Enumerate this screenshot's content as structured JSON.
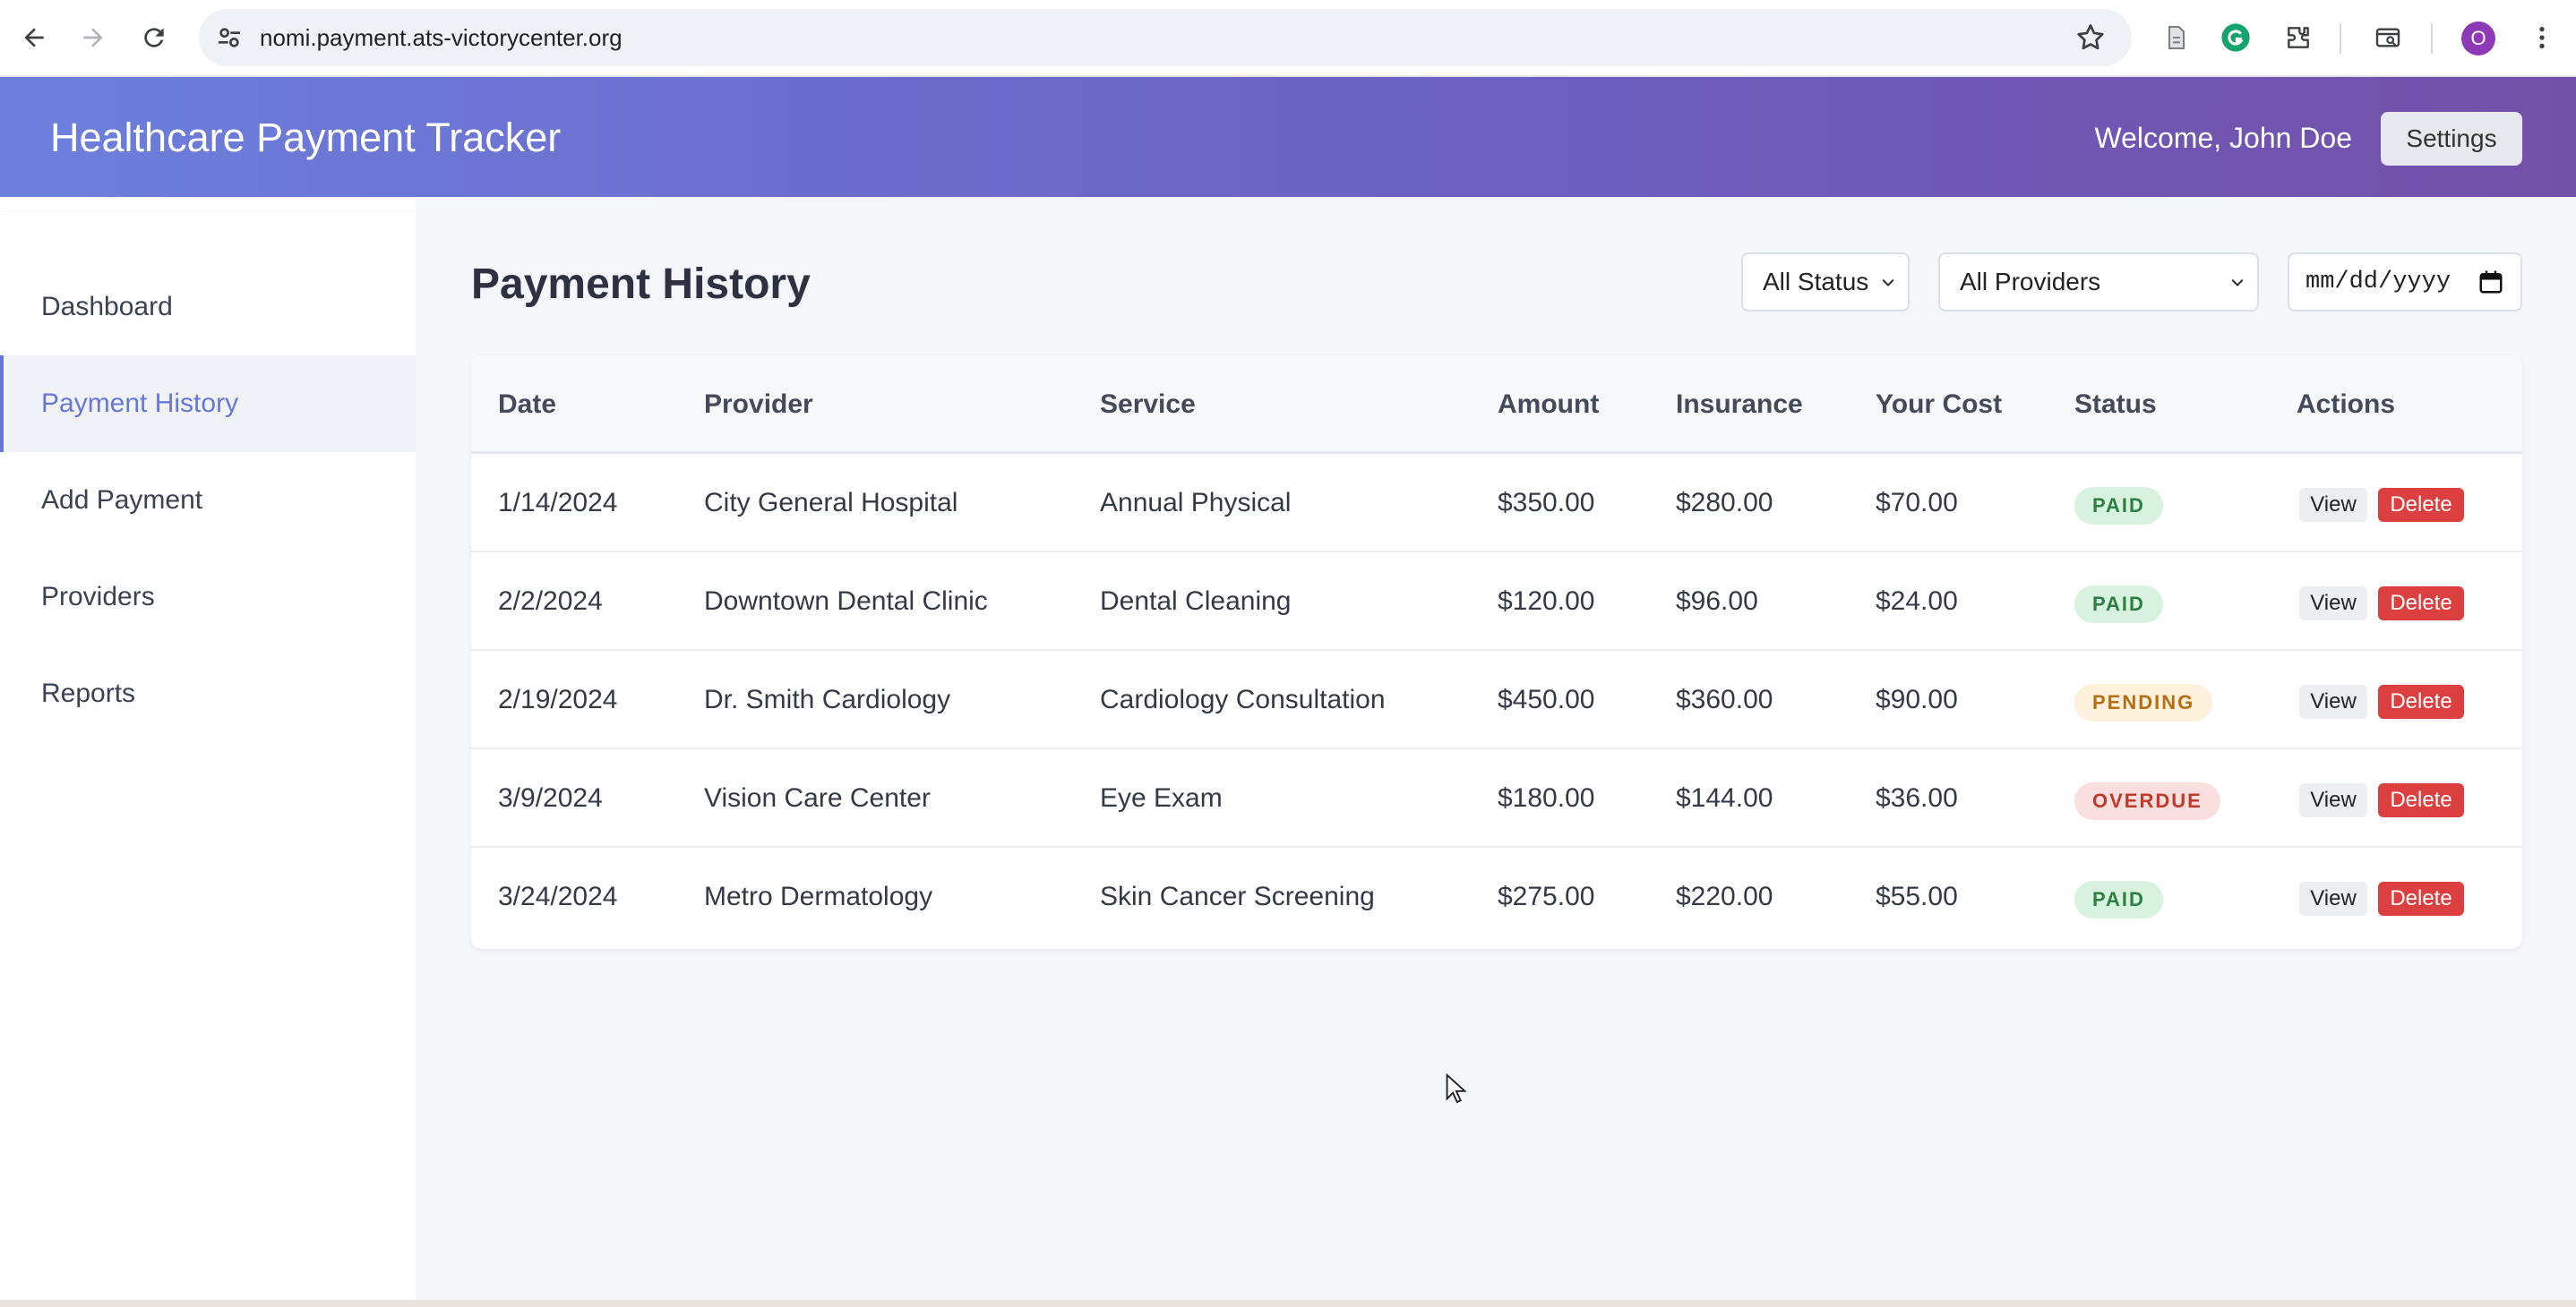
{
  "browser": {
    "url": "nomi.payment.ats-victorycenter.org",
    "profile_initial": "O"
  },
  "header": {
    "title": "Healthcare Payment Tracker",
    "welcome": "Welcome, John Doe",
    "settings_label": "Settings"
  },
  "sidebar": {
    "items": [
      {
        "label": "Dashboard"
      },
      {
        "label": "Payment History"
      },
      {
        "label": "Add Payment"
      },
      {
        "label": "Providers"
      },
      {
        "label": "Reports"
      }
    ],
    "active": "Payment History"
  },
  "main": {
    "title": "Payment History",
    "filters": {
      "status": "All Status",
      "provider": "All Providers",
      "date_placeholder": "mm/dd/yyyy"
    },
    "table": {
      "headers": [
        "Date",
        "Provider",
        "Service",
        "Amount",
        "Insurance",
        "Your Cost",
        "Status",
        "Actions"
      ],
      "rows": [
        {
          "date": "1/14/2024",
          "provider": "City General Hospital",
          "service": "Annual Physical",
          "amount": "$350.00",
          "insurance": "$280.00",
          "cost": "$70.00",
          "status": "PAID"
        },
        {
          "date": "2/2/2024",
          "provider": "Downtown Dental Clinic",
          "service": "Dental Cleaning",
          "amount": "$120.00",
          "insurance": "$96.00",
          "cost": "$24.00",
          "status": "PAID"
        },
        {
          "date": "2/19/2024",
          "provider": "Dr. Smith Cardiology",
          "service": "Cardiology Consultation",
          "amount": "$450.00",
          "insurance": "$360.00",
          "cost": "$90.00",
          "status": "PENDING"
        },
        {
          "date": "3/9/2024",
          "provider": "Vision Care Center",
          "service": "Eye Exam",
          "amount": "$180.00",
          "insurance": "$144.00",
          "cost": "$36.00",
          "status": "OVERDUE"
        },
        {
          "date": "3/24/2024",
          "provider": "Metro Dermatology",
          "service": "Skin Cancer Screening",
          "amount": "$275.00",
          "insurance": "$220.00",
          "cost": "$55.00",
          "status": "PAID"
        }
      ],
      "view_label": "View",
      "delete_label": "Delete"
    }
  },
  "colors": {
    "header_gradient_start": "#6c7fdc",
    "header_gradient_end": "#7350a8",
    "accent": "#6777d6",
    "paid": "#2e7d43",
    "pending": "#b76e13",
    "overdue": "#c0392b",
    "delete": "#dc3f3f"
  }
}
